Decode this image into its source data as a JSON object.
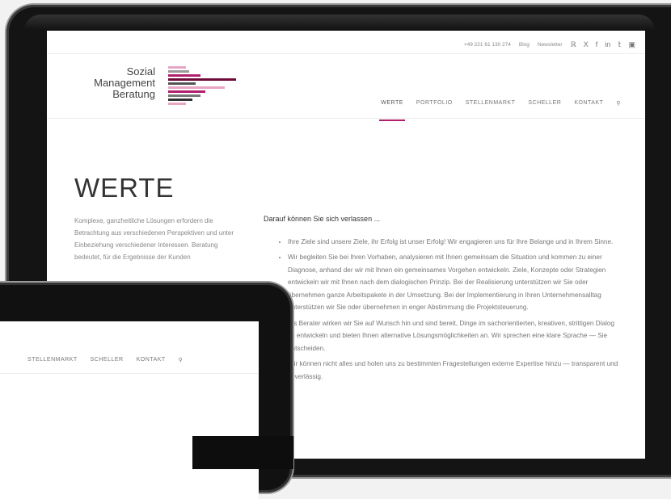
{
  "topbar": {
    "phone": "+49 221 61 130 274",
    "blog": "Blog",
    "newsletter": "Newsletter",
    "social_icons": [
      "rss-icon",
      "xing-icon",
      "facebook-icon",
      "linkedin-icon",
      "twitter-icon",
      "youtube-icon"
    ],
    "social_glyphs": [
      "ℝ",
      "X",
      "f",
      "in",
      "𝕥",
      "▣"
    ]
  },
  "logo": {
    "line1": "Sozial",
    "line2": "Management",
    "line3": "Beratung",
    "colors": [
      "#e7a6c4",
      "#777777",
      "#b01e6c",
      "#6e0a3a",
      "#4a4a4a"
    ]
  },
  "nav": {
    "items": [
      "WERTE",
      "PORTFOLIO",
      "STELLENMARKT",
      "SCHELLER",
      "KONTAKT"
    ],
    "active": "WERTE",
    "search_glyph": "⚲",
    "accent": "#b01e6c"
  },
  "page": {
    "title": "WERTE",
    "intro": "Komplexe, ganzheitliche Lösungen erfordern die Betrachtung aus verschiedenen Perspektiven und unter Einbeziehung verschiedener Interessen. Beratung bedeutet, für die Ergebnisse der Kunden",
    "lead": "Darauf können Sie sich verlassen ...",
    "bullets": [
      "Ihre Ziele sind unsere Ziele, ihr Erfolg ist unser Erfolg! Wir engagieren uns für Ihre Belange und in Ihrem Sinne.",
      "Wir begleiten Sie bei Ihren Vorhaben, analysieren mit Ihnen gemeinsam die Situation und kommen zu einer Diagnose, anhand der wir mit Ihnen ein gemeinsames Vorgehen entwickeln. Ziele, Konzepte oder Strategien entwickeln wir mit Ihnen nach dem dialogischen Prinzip. Bei der Realisierung unterstützen wir Sie oder übernehmen ganze Arbeitspakete in der Umsetzung. Bei der Implementierung in Ihren Unternehmensalltag unterstützen wir Sie oder übernehmen in enger Abstimmung die Projektsteuerung.",
      "Als Berater wirken wir Sie auf Wunsch hin und sind bereit, Dinge im sachorientierten, kreativen, strittigen Dialog zu entwickeln und bieten Ihnen alternative Lösungsmöglichkeiten an. Wir sprechen eine klare Sprache — Sie entscheiden.",
      "Wir können nicht alles und holen uns zu bestimmten Fragestellungen externe Expertise hinzu — transparent und zuverlässig."
    ]
  },
  "tablet": {
    "nav_items": [
      "STELLENMARKT",
      "SCHELLER",
      "KONTAKT"
    ],
    "search_glyph": "⚲"
  }
}
